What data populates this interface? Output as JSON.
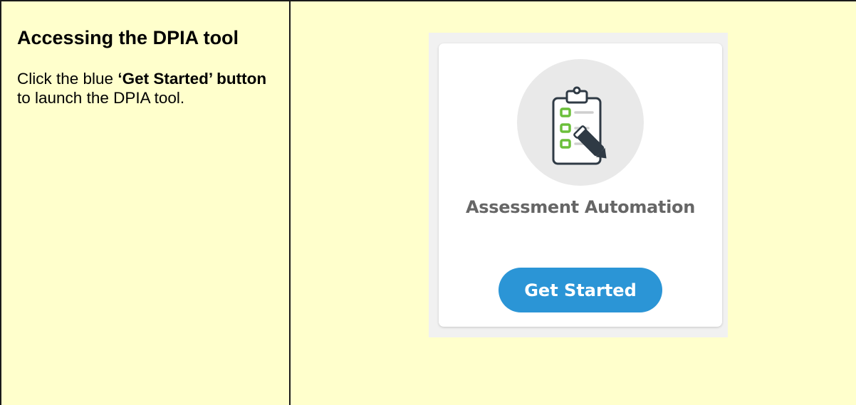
{
  "left_panel": {
    "heading": "Accessing the DPIA tool",
    "instruction_prefix": "Click the blue ",
    "instruction_bold": "‘Get Started’ button",
    "instruction_suffix": " to launch the DPIA tool."
  },
  "card": {
    "icon": "clipboard-checklist-icon",
    "title": "Assessment Automation",
    "button_label": "Get Started"
  },
  "colors": {
    "cell_background": "#ffffcc",
    "button_blue": "#2b95d6",
    "checkbox_green": "#6bbf3a",
    "title_gray": "#666666"
  }
}
